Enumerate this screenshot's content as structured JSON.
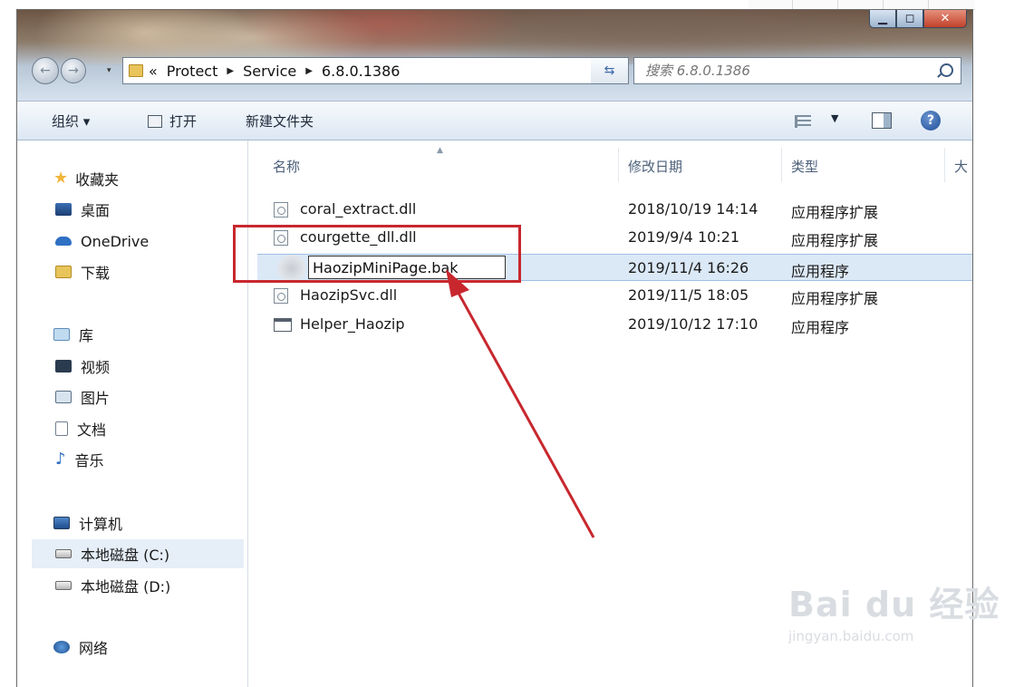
{
  "address": {
    "overflow": "«",
    "segments": [
      "Protect",
      "Service",
      "6.8.0.1386"
    ]
  },
  "search": {
    "placeholder": "搜索 6.8.0.1386"
  },
  "toolbar": {
    "organize": "组织 ▾",
    "burn": "打开",
    "new_folder": "新建文件夹"
  },
  "navpane": {
    "favorites": "收藏夹",
    "desktop": "桌面",
    "onedrive": "OneDrive",
    "downloads": "下载",
    "libraries": "库",
    "videos": "视频",
    "pictures": "图片",
    "documents": "文档",
    "music": "音乐",
    "computer": "计算机",
    "drive_c": "本地磁盘 (C:)",
    "drive_d": "本地磁盘 (D:)",
    "network": "网络"
  },
  "columns": {
    "name": "名称",
    "date": "修改日期",
    "type": "类型",
    "size": "大"
  },
  "files": [
    {
      "name": "coral_extract.dll",
      "date": "2018/10/19 14:14",
      "type": "应用程序扩展"
    },
    {
      "name": "courgette_dll.dll",
      "date": "2019/9/4 10:21",
      "type": "应用程序扩展"
    },
    {
      "name": "HaozipMiniPage.bak",
      "date": "2019/11/4 16:26",
      "type": "应用程序"
    },
    {
      "name": "HaozipSvc.dll",
      "date": "2019/11/5 18:05",
      "type": "应用程序扩展"
    },
    {
      "name": "Helper_Haozip",
      "date": "2019/10/12 17:10",
      "type": "应用程序"
    }
  ],
  "watermark": {
    "brand": "Bai du 经验",
    "url": "jingyan.baidu.com"
  },
  "colors": {
    "highlight": "#c8272e",
    "selection": "#dbe8f6",
    "close_button": "#c0412a"
  }
}
